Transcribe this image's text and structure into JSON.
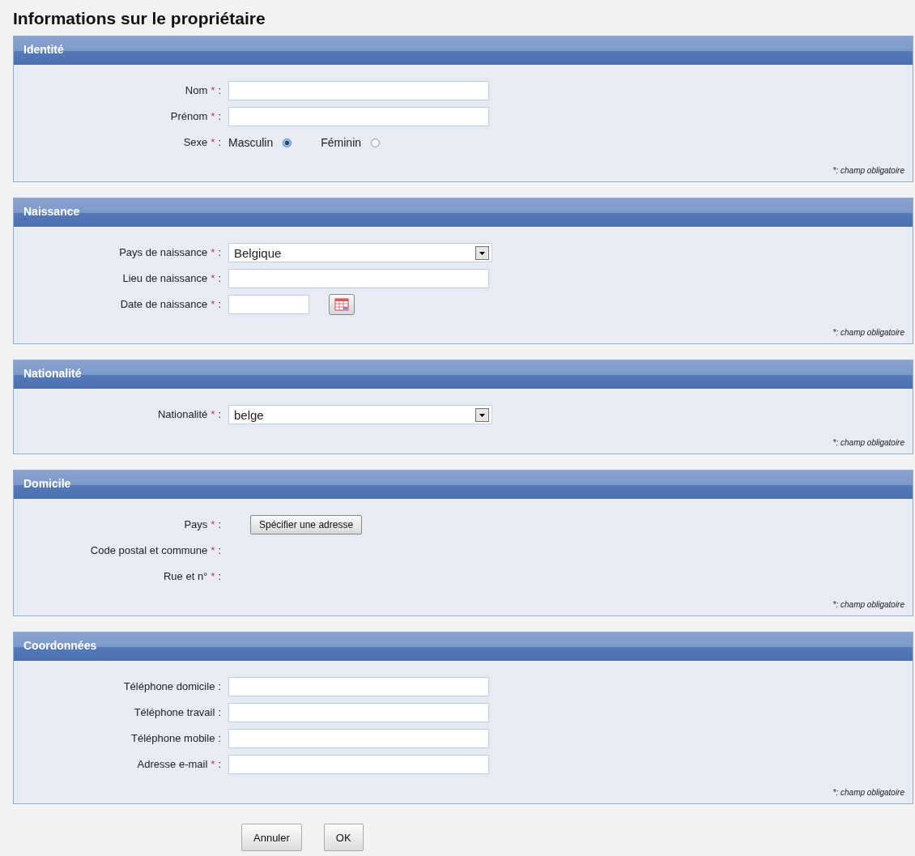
{
  "title": "Informations sur le propriétaire",
  "sections": [
    {
      "title": "Identité",
      "fields": [
        {
          "kind": "text",
          "label": "Nom",
          "required_mark": "*",
          "separator": ":"
        },
        {
          "kind": "text",
          "label": "Prénom",
          "required_mark": "*",
          "separator": ":"
        },
        {
          "kind": "radio",
          "label": "Sexe",
          "required_mark": "*",
          "separator": ":",
          "options": [
            {
              "label": "Masculin",
              "selected": true
            },
            {
              "label": "Féminin",
              "selected": false
            }
          ]
        }
      ],
      "note": "*: champ obligatoire"
    },
    {
      "title": "Naissance",
      "fields": [
        {
          "kind": "select",
          "label": "Pays de naissance",
          "required_mark": "*",
          "separator": ":",
          "value": "Belgique"
        },
        {
          "kind": "text",
          "label": "Lieu de naissance",
          "required_mark": "*",
          "separator": ":"
        },
        {
          "kind": "date",
          "label": "Date de naissance",
          "required_mark": "*",
          "separator": ":"
        }
      ],
      "note": "*: champ obligatoire"
    },
    {
      "title": "Nationalité",
      "fields": [
        {
          "kind": "select",
          "label": "Nationalité",
          "required_mark": "*",
          "separator": ":",
          "value": "belge"
        }
      ],
      "note": "*: champ obligatoire"
    },
    {
      "title": "Domicile",
      "fields": [
        {
          "kind": "button",
          "label": "Pays",
          "required_mark": "*",
          "separator": ":",
          "value": "Spécifier une adresse"
        },
        {
          "kind": "static",
          "label": "Code postal et commune",
          "required_mark": "*",
          "separator": ":"
        },
        {
          "kind": "static",
          "label": "Rue et n°",
          "required_mark": "*",
          "separator": ":"
        }
      ],
      "note": "*: champ obligatoire"
    },
    {
      "title": "Coordonnées",
      "fields": [
        {
          "kind": "text",
          "label": "Téléphone domicile",
          "separator": ":"
        },
        {
          "kind": "text",
          "label": "Téléphone travail",
          "separator": ":"
        },
        {
          "kind": "text",
          "label": "Téléphone mobile",
          "separator": ":"
        },
        {
          "kind": "text",
          "label": "Adresse e-mail",
          "required_mark": "*",
          "separator": ":"
        }
      ],
      "note": "*: champ obligatoire"
    }
  ],
  "buttons": [
    {
      "label": "Annuler"
    },
    {
      "label": "OK"
    }
  ]
}
